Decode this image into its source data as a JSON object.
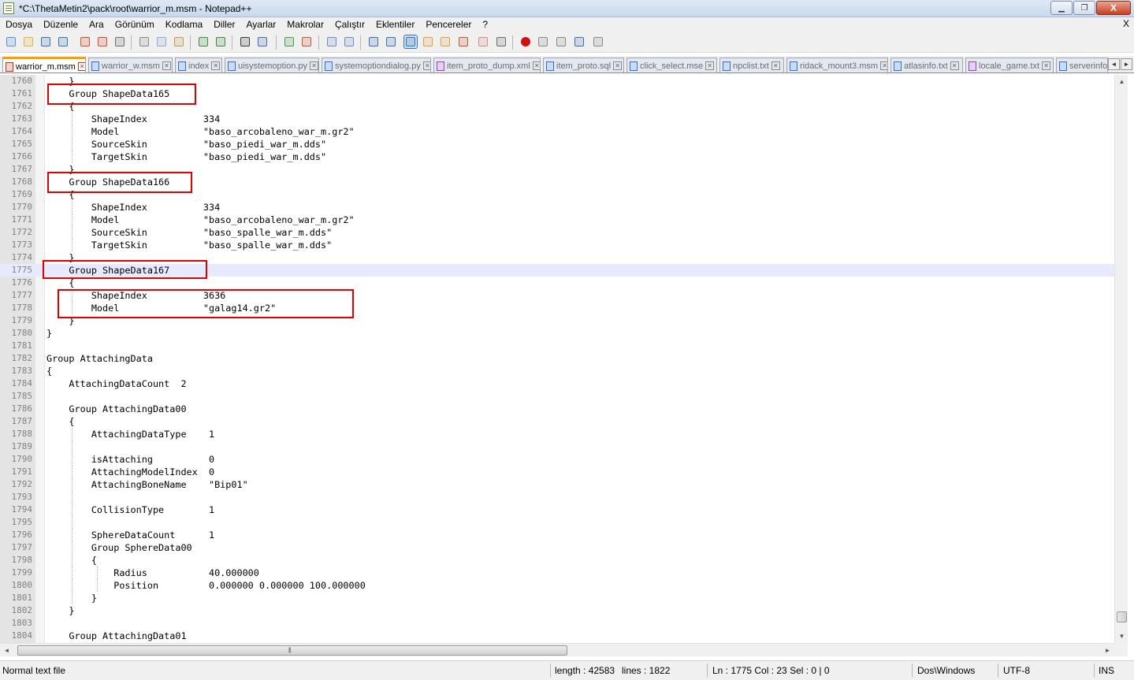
{
  "window": {
    "title": "*C:\\ThetaMetin2\\pack\\root\\warrior_m.msm - Notepad++",
    "minimize_glyph": "▁",
    "maximize_glyph": "❐",
    "close_glyph": "X"
  },
  "menu": {
    "items": [
      "Dosya",
      "Düzenle",
      "Ara",
      "Görünüm",
      "Kodlama",
      "Diller",
      "Ayarlar",
      "Makrolar",
      "Çalıştır",
      "Eklentiler",
      "Pencereler",
      "?"
    ],
    "close_doc_glyph": "X"
  },
  "toolbar": {
    "buttons": [
      {
        "icon": "new-file-icon",
        "color": "#5b8fd6"
      },
      {
        "icon": "open-file-icon",
        "color": "#e3b33c"
      },
      {
        "icon": "save-icon",
        "color": "#3d6db5"
      },
      {
        "icon": "save-all-icon",
        "color": "#3d6db5"
      },
      {
        "icon": "close-file-icon",
        "color": "#d24b2a"
      },
      {
        "icon": "close-all-icon",
        "color": "#d24b2a"
      },
      {
        "icon": "print-icon",
        "color": "#6f6f6f"
      },
      {
        "icon": "cut-icon",
        "color": "#8a8a8a"
      },
      {
        "icon": "copy-icon",
        "color": "#8fa9cf"
      },
      {
        "icon": "paste-icon",
        "color": "#c49a4a"
      },
      {
        "icon": "undo-icon",
        "color": "#3f8a3f"
      },
      {
        "icon": "redo-icon",
        "color": "#3f8a3f"
      },
      {
        "icon": "find-icon",
        "color": "#3a3a3a"
      },
      {
        "icon": "replace-icon",
        "color": "#3d6db5"
      },
      {
        "icon": "zoom-in-icon",
        "color": "#4a9a4a"
      },
      {
        "icon": "zoom-out-icon",
        "color": "#c9542e"
      },
      {
        "icon": "sync-vertical-icon",
        "color": "#6a8fc7"
      },
      {
        "icon": "sync-horizontal-icon",
        "color": "#6a8fc7"
      },
      {
        "icon": "word-wrap-icon",
        "color": "#3d6db5"
      },
      {
        "icon": "show-all-chars-icon",
        "color": "#3d6db5"
      },
      {
        "icon": "indent-guide-icon",
        "color": "#3d6db5"
      },
      {
        "icon": "user-lang-icon",
        "color": "#e0a23a"
      },
      {
        "icon": "doc-map-icon",
        "color": "#e0a23a"
      },
      {
        "icon": "function-list-icon",
        "color": "#c9542e"
      },
      {
        "icon": "folder-workspace-icon",
        "color": "#d98b7a"
      },
      {
        "icon": "monitoring-icon",
        "color": "#6a6a6a"
      },
      {
        "icon": "record-macro-icon",
        "color": "#d01010"
      },
      {
        "icon": "stop-record-icon",
        "color": "#8a8a8a"
      },
      {
        "icon": "play-macro-icon",
        "color": "#8a8a8a"
      },
      {
        "icon": "run-macro-multiple-icon",
        "color": "#3d6db5"
      },
      {
        "icon": "save-macro-icon",
        "color": "#8a8a8a"
      }
    ]
  },
  "tabs": [
    {
      "label": "warrior_m.msm",
      "active": true,
      "kind": "modified"
    },
    {
      "label": "warrior_w.msm",
      "active": false,
      "kind": "normal"
    },
    {
      "label": "index",
      "active": false,
      "kind": "normal"
    },
    {
      "label": "uisystemoption.py",
      "active": false,
      "kind": "normal"
    },
    {
      "label": "systemoptiondialog.py",
      "active": false,
      "kind": "normal"
    },
    {
      "label": "item_proto_dump.xml",
      "active": false,
      "kind": "purple"
    },
    {
      "label": "item_proto.sql",
      "active": false,
      "kind": "normal"
    },
    {
      "label": "click_select.mse",
      "active": false,
      "kind": "normal"
    },
    {
      "label": "npclist.txt",
      "active": false,
      "kind": "normal"
    },
    {
      "label": "ridack_mount3.msm",
      "active": false,
      "kind": "normal"
    },
    {
      "label": "atlasinfo.txt",
      "active": false,
      "kind": "normal"
    },
    {
      "label": "locale_game.txt",
      "active": false,
      "kind": "purple"
    },
    {
      "label": "serverinfo",
      "active": false,
      "kind": "normal"
    }
  ],
  "tab_scroll": {
    "left": "◄",
    "right": "►"
  },
  "editor": {
    "current_line": "1775",
    "lines": [
      {
        "n": "1760",
        "text": "    }",
        "indent": 1
      },
      {
        "n": "1761",
        "text": "    Group ShapeData165",
        "indent": 1
      },
      {
        "n": "1762",
        "text": "    {",
        "indent": 1
      },
      {
        "n": "1763",
        "text": "        ShapeIndex          334",
        "indent": 2
      },
      {
        "n": "1764",
        "text": "        Model               \"baso_arcobaleno_war_m.gr2\"",
        "indent": 2
      },
      {
        "n": "1765",
        "text": "        SourceSkin          \"baso_piedi_war_m.dds\"",
        "indent": 2
      },
      {
        "n": "1766",
        "text": "        TargetSkin          \"baso_piedi_war_m.dds\"",
        "indent": 2
      },
      {
        "n": "1767",
        "text": "    }",
        "indent": 1
      },
      {
        "n": "1768",
        "text": "    Group ShapeData166",
        "indent": 1
      },
      {
        "n": "1769",
        "text": "    {",
        "indent": 1
      },
      {
        "n": "1770",
        "text": "        ShapeIndex          334",
        "indent": 2
      },
      {
        "n": "1771",
        "text": "        Model               \"baso_arcobaleno_war_m.gr2\"",
        "indent": 2
      },
      {
        "n": "1772",
        "text": "        SourceSkin          \"baso_spalle_war_m.dds\"",
        "indent": 2
      },
      {
        "n": "1773",
        "text": "        TargetSkin          \"baso_spalle_war_m.dds\"",
        "indent": 2
      },
      {
        "n": "1774",
        "text": "    }",
        "indent": 1
      },
      {
        "n": "1775",
        "text": "    Group ShapeData167",
        "indent": 1
      },
      {
        "n": "1776",
        "text": "    {",
        "indent": 1
      },
      {
        "n": "1777",
        "text": "        ShapeIndex          3636",
        "indent": 2
      },
      {
        "n": "1778",
        "text": "        Model               \"galag14.gr2\"",
        "indent": 2
      },
      {
        "n": "1779",
        "text": "    }",
        "indent": 1
      },
      {
        "n": "1780",
        "text": "}",
        "indent": 0
      },
      {
        "n": "1781",
        "text": "",
        "indent": 0
      },
      {
        "n": "1782",
        "text": "Group AttachingData",
        "indent": 0
      },
      {
        "n": "1783",
        "text": "{",
        "indent": 0
      },
      {
        "n": "1784",
        "text": "    AttachingDataCount  2",
        "indent": 1
      },
      {
        "n": "1785",
        "text": "",
        "indent": 1
      },
      {
        "n": "1786",
        "text": "    Group AttachingData00",
        "indent": 1
      },
      {
        "n": "1787",
        "text": "    {",
        "indent": 1
      },
      {
        "n": "1788",
        "text": "        AttachingDataType    1",
        "indent": 2
      },
      {
        "n": "1789",
        "text": "",
        "indent": 2
      },
      {
        "n": "1790",
        "text": "        isAttaching          0",
        "indent": 2
      },
      {
        "n": "1791",
        "text": "        AttachingModelIndex  0",
        "indent": 2
      },
      {
        "n": "1792",
        "text": "        AttachingBoneName    \"Bip01\"",
        "indent": 2
      },
      {
        "n": "1793",
        "text": "",
        "indent": 2
      },
      {
        "n": "1794",
        "text": "        CollisionType        1",
        "indent": 2
      },
      {
        "n": "1795",
        "text": "",
        "indent": 2
      },
      {
        "n": "1796",
        "text": "        SphereDataCount      1",
        "indent": 2
      },
      {
        "n": "1797",
        "text": "        Group SphereData00",
        "indent": 2
      },
      {
        "n": "1798",
        "text": "        {",
        "indent": 2
      },
      {
        "n": "1799",
        "text": "            Radius           40.000000",
        "indent": 3
      },
      {
        "n": "1800",
        "text": "            Position         0.000000 0.000000 100.000000",
        "indent": 3
      },
      {
        "n": "1801",
        "text": "        }",
        "indent": 2
      },
      {
        "n": "1802",
        "text": "    }",
        "indent": 1
      },
      {
        "n": "1803",
        "text": "",
        "indent": 1
      },
      {
        "n": "1804",
        "text": "    Group AttachingData01",
        "indent": 1
      }
    ],
    "highlight_color": "#e00000"
  },
  "scrollbars": {
    "up": "▲",
    "down": "▼",
    "left": "◄",
    "right": "►",
    "grip": "|||"
  },
  "status": {
    "file_type": "Normal text file",
    "length": "length : 42583",
    "lines": "lines : 1822",
    "position": "Ln : 1775    Col : 23    Sel : 0 | 0",
    "eol": "Dos\\Windows",
    "encoding": "UTF-8",
    "mode": "INS"
  }
}
